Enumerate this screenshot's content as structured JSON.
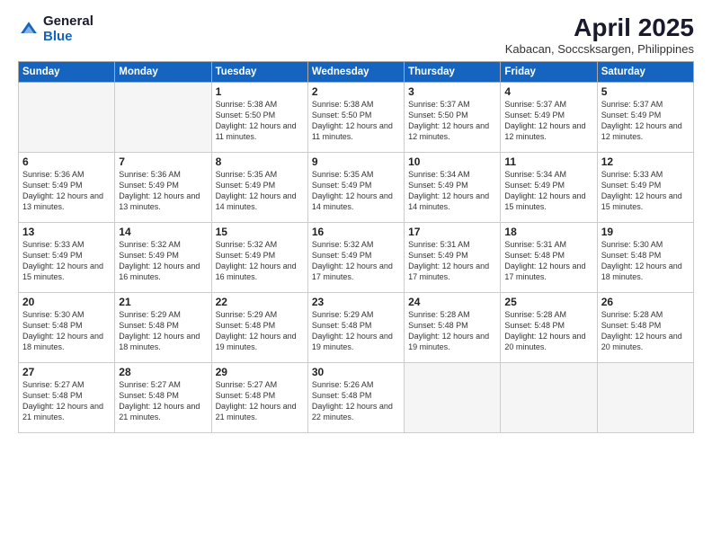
{
  "logo": {
    "general": "General",
    "blue": "Blue"
  },
  "title": "April 2025",
  "subtitle": "Kabacan, Soccsksargen, Philippines",
  "days_of_week": [
    "Sunday",
    "Monday",
    "Tuesday",
    "Wednesday",
    "Thursday",
    "Friday",
    "Saturday"
  ],
  "weeks": [
    [
      {
        "day": "",
        "info": ""
      },
      {
        "day": "",
        "info": ""
      },
      {
        "day": "1",
        "info": "Sunrise: 5:38 AM\nSunset: 5:50 PM\nDaylight: 12 hours and 11 minutes."
      },
      {
        "day": "2",
        "info": "Sunrise: 5:38 AM\nSunset: 5:50 PM\nDaylight: 12 hours and 11 minutes."
      },
      {
        "day": "3",
        "info": "Sunrise: 5:37 AM\nSunset: 5:50 PM\nDaylight: 12 hours and 12 minutes."
      },
      {
        "day": "4",
        "info": "Sunrise: 5:37 AM\nSunset: 5:49 PM\nDaylight: 12 hours and 12 minutes."
      },
      {
        "day": "5",
        "info": "Sunrise: 5:37 AM\nSunset: 5:49 PM\nDaylight: 12 hours and 12 minutes."
      }
    ],
    [
      {
        "day": "6",
        "info": "Sunrise: 5:36 AM\nSunset: 5:49 PM\nDaylight: 12 hours and 13 minutes."
      },
      {
        "day": "7",
        "info": "Sunrise: 5:36 AM\nSunset: 5:49 PM\nDaylight: 12 hours and 13 minutes."
      },
      {
        "day": "8",
        "info": "Sunrise: 5:35 AM\nSunset: 5:49 PM\nDaylight: 12 hours and 14 minutes."
      },
      {
        "day": "9",
        "info": "Sunrise: 5:35 AM\nSunset: 5:49 PM\nDaylight: 12 hours and 14 minutes."
      },
      {
        "day": "10",
        "info": "Sunrise: 5:34 AM\nSunset: 5:49 PM\nDaylight: 12 hours and 14 minutes."
      },
      {
        "day": "11",
        "info": "Sunrise: 5:34 AM\nSunset: 5:49 PM\nDaylight: 12 hours and 15 minutes."
      },
      {
        "day": "12",
        "info": "Sunrise: 5:33 AM\nSunset: 5:49 PM\nDaylight: 12 hours and 15 minutes."
      }
    ],
    [
      {
        "day": "13",
        "info": "Sunrise: 5:33 AM\nSunset: 5:49 PM\nDaylight: 12 hours and 15 minutes."
      },
      {
        "day": "14",
        "info": "Sunrise: 5:32 AM\nSunset: 5:49 PM\nDaylight: 12 hours and 16 minutes."
      },
      {
        "day": "15",
        "info": "Sunrise: 5:32 AM\nSunset: 5:49 PM\nDaylight: 12 hours and 16 minutes."
      },
      {
        "day": "16",
        "info": "Sunrise: 5:32 AM\nSunset: 5:49 PM\nDaylight: 12 hours and 17 minutes."
      },
      {
        "day": "17",
        "info": "Sunrise: 5:31 AM\nSunset: 5:49 PM\nDaylight: 12 hours and 17 minutes."
      },
      {
        "day": "18",
        "info": "Sunrise: 5:31 AM\nSunset: 5:48 PM\nDaylight: 12 hours and 17 minutes."
      },
      {
        "day": "19",
        "info": "Sunrise: 5:30 AM\nSunset: 5:48 PM\nDaylight: 12 hours and 18 minutes."
      }
    ],
    [
      {
        "day": "20",
        "info": "Sunrise: 5:30 AM\nSunset: 5:48 PM\nDaylight: 12 hours and 18 minutes."
      },
      {
        "day": "21",
        "info": "Sunrise: 5:29 AM\nSunset: 5:48 PM\nDaylight: 12 hours and 18 minutes."
      },
      {
        "day": "22",
        "info": "Sunrise: 5:29 AM\nSunset: 5:48 PM\nDaylight: 12 hours and 19 minutes."
      },
      {
        "day": "23",
        "info": "Sunrise: 5:29 AM\nSunset: 5:48 PM\nDaylight: 12 hours and 19 minutes."
      },
      {
        "day": "24",
        "info": "Sunrise: 5:28 AM\nSunset: 5:48 PM\nDaylight: 12 hours and 19 minutes."
      },
      {
        "day": "25",
        "info": "Sunrise: 5:28 AM\nSunset: 5:48 PM\nDaylight: 12 hours and 20 minutes."
      },
      {
        "day": "26",
        "info": "Sunrise: 5:28 AM\nSunset: 5:48 PM\nDaylight: 12 hours and 20 minutes."
      }
    ],
    [
      {
        "day": "27",
        "info": "Sunrise: 5:27 AM\nSunset: 5:48 PM\nDaylight: 12 hours and 21 minutes."
      },
      {
        "day": "28",
        "info": "Sunrise: 5:27 AM\nSunset: 5:48 PM\nDaylight: 12 hours and 21 minutes."
      },
      {
        "day": "29",
        "info": "Sunrise: 5:27 AM\nSunset: 5:48 PM\nDaylight: 12 hours and 21 minutes."
      },
      {
        "day": "30",
        "info": "Sunrise: 5:26 AM\nSunset: 5:48 PM\nDaylight: 12 hours and 22 minutes."
      },
      {
        "day": "",
        "info": ""
      },
      {
        "day": "",
        "info": ""
      },
      {
        "day": "",
        "info": ""
      }
    ]
  ]
}
